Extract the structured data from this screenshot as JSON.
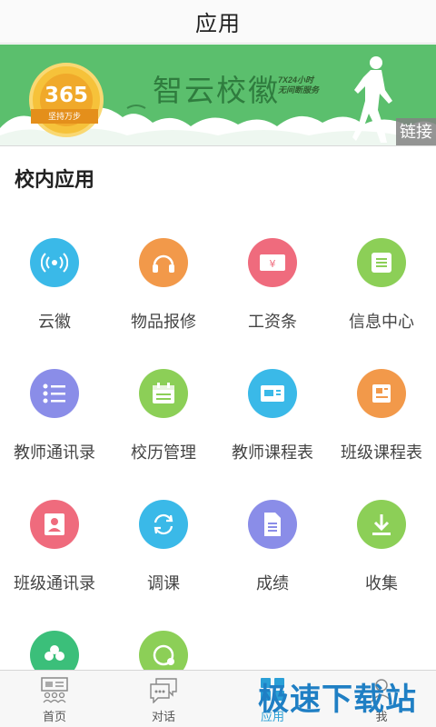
{
  "header": {
    "title": "应用"
  },
  "banner": {
    "title": "智云校徽",
    "sub_line1": "7X24小时",
    "sub_line2": "无间断服务",
    "medal_number": "365",
    "medal_ribbon": "坚持万步",
    "link_label": "链接"
  },
  "section": {
    "title": "校内应用"
  },
  "apps": [
    {
      "label": "云徽",
      "icon": "wifi-icon",
      "color": "#3ab9e8"
    },
    {
      "label": "物品报修",
      "icon": "headphones-icon",
      "color": "#f2994a"
    },
    {
      "label": "工资条",
      "icon": "yen-icon",
      "color": "#ef6b7d"
    },
    {
      "label": "信息中心",
      "icon": "document-icon",
      "color": "#8ccf57"
    },
    {
      "label": "教师通讯录",
      "icon": "list-icon",
      "color": "#8a8de8"
    },
    {
      "label": "校历管理",
      "icon": "calendar-icon",
      "color": "#8ccf57"
    },
    {
      "label": "教师课程表",
      "icon": "card-icon",
      "color": "#3ab9e8"
    },
    {
      "label": "班级课程表",
      "icon": "doc-icon",
      "color": "#f2994a"
    },
    {
      "label": "班级通讯录",
      "icon": "contact-icon",
      "color": "#ef6b7d"
    },
    {
      "label": "调课",
      "icon": "refresh-icon",
      "color": "#3ab9e8"
    },
    {
      "label": "成绩",
      "icon": "file-icon",
      "color": "#8a8de8"
    },
    {
      "label": "收集",
      "icon": "download-icon",
      "color": "#8ccf57"
    },
    {
      "label": "",
      "icon": "clover-icon",
      "color": "#3bbf7a"
    },
    {
      "label": "",
      "icon": "circle-plus-icon",
      "color": "#8ccf57"
    }
  ],
  "tabs": [
    {
      "label": "首页",
      "icon": "home-icon"
    },
    {
      "label": "对话",
      "icon": "chat-icon"
    },
    {
      "label": "应用",
      "icon": "apps-icon",
      "active": true
    },
    {
      "label": "我",
      "icon": "user-icon"
    }
  ],
  "watermark": {
    "text": "极速下载站"
  }
}
